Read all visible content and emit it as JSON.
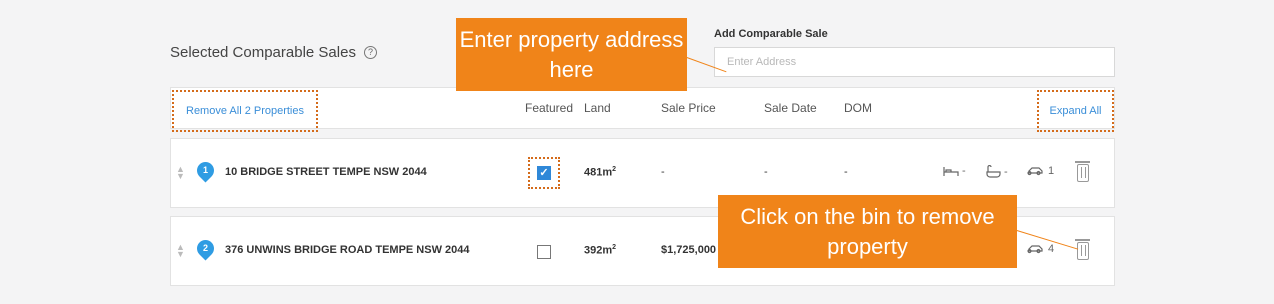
{
  "section": {
    "title": "Selected Comparable Sales",
    "help_icon": "question-circle-icon"
  },
  "add_sale": {
    "label": "Add Comparable Sale",
    "placeholder": "Enter Address",
    "value": ""
  },
  "table": {
    "remove_all_label": "Remove All 2 Properties",
    "expand_all_label": "Expand All",
    "headers": {
      "featured": "Featured",
      "land": "Land",
      "sale_price": "Sale Price",
      "sale_date": "Sale Date",
      "dom": "DOM"
    },
    "rows": [
      {
        "index": "1",
        "address": "10 BRIDGE STREET TEMPE NSW 2044",
        "featured": true,
        "land": "481m",
        "land_unit": "2",
        "sale_price": "-",
        "sale_date": "-",
        "dom": "-",
        "beds": "-",
        "baths": "-",
        "cars": "1"
      },
      {
        "index": "2",
        "address": "376 UNWINS BRIDGE ROAD TEMPE NSW 2044",
        "featured": false,
        "land": "392m",
        "land_unit": "2",
        "sale_price": "$1,725,000",
        "cars": "4"
      }
    ]
  },
  "callouts": {
    "address": "Enter property address here",
    "bin": "Click on the bin to remove property"
  },
  "colors": {
    "accent": "#f08419",
    "link": "#3a8ed8",
    "pin": "#2f9ce3",
    "checkbox": "#2f88d8"
  }
}
